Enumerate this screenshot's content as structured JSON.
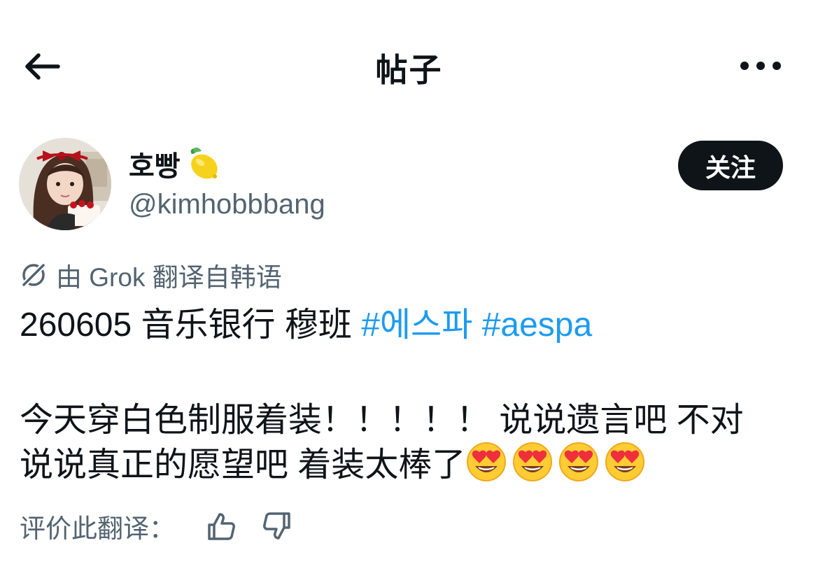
{
  "header": {
    "title": "帖子",
    "back_icon": "arrow-left-icon",
    "more_icon": "more-horizontal-icon"
  },
  "author": {
    "display_name": "호빵",
    "display_name_emoji": "lemon-icon",
    "handle": "@kimhobbbang",
    "avatar": "profile-photo",
    "follow_label": "关注"
  },
  "translation": {
    "icon": "translate-icon",
    "label": "由 Grok 翻译自韩语"
  },
  "post": {
    "line1_text": "260605 音乐银行 穆班 ",
    "hashtag1": "#에스파",
    "hashtag2": "#aespa",
    "line2": "今天穿白色制服着装！！！！！ 说说遗言吧 不对",
    "line3": "说说真正的愿望吧 着装太棒了",
    "emojis": [
      "heart-eyes-emoji",
      "heart-eyes-emoji",
      "heart-eyes-emoji",
      "heart-eyes-emoji"
    ]
  },
  "rating": {
    "label": "评价此翻译：",
    "thumbs_up_icon": "thumbs-up-icon",
    "thumbs_down_icon": "thumbs-down-icon"
  },
  "colors": {
    "text": "#0f1419",
    "secondary": "#536471",
    "link": "#1d9bf0",
    "button_bg": "#0f1419"
  }
}
